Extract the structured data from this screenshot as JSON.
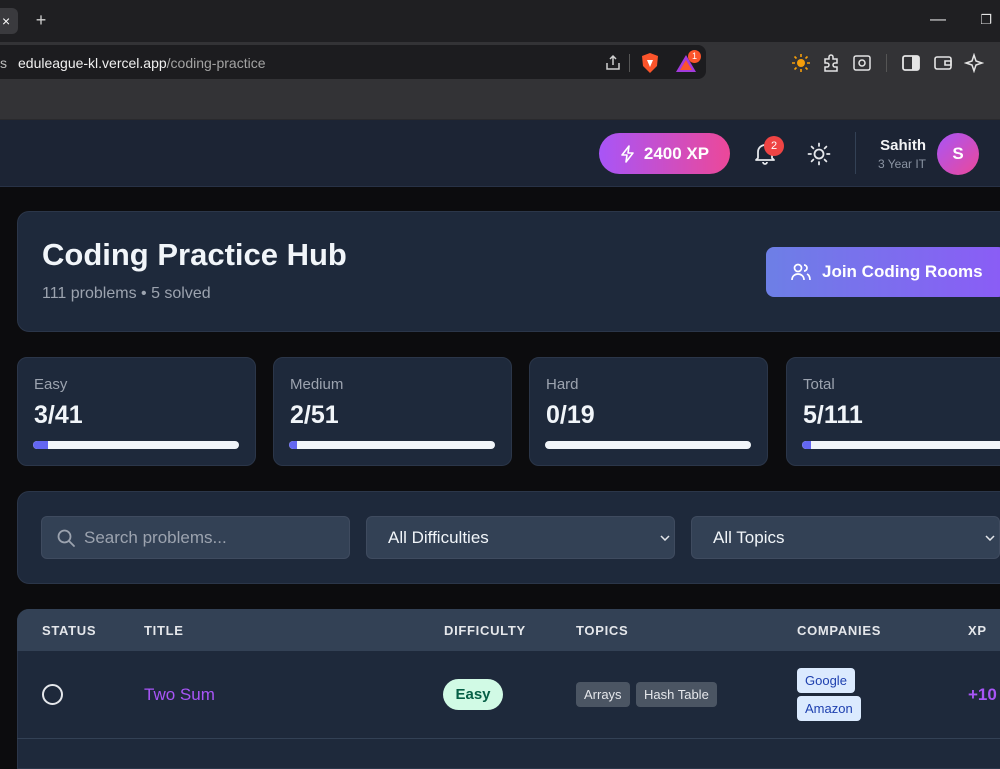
{
  "browser": {
    "tab_close": "×",
    "new_tab": "+",
    "url_prefix": "s",
    "url_host": "eduleague-kl.vercel.app",
    "url_path": "/coding-practice",
    "brave_badge": "1",
    "minimize": "—",
    "restore": "❐"
  },
  "header": {
    "xp": "2400 XP",
    "notifications": "2",
    "user_name": "Sahith",
    "user_sub": "3 Year IT",
    "avatar_initial": "S",
    "colors": {
      "xp_gradient": [
        "#a855f7",
        "#ec4899"
      ],
      "badge": "#ef4444"
    }
  },
  "hero": {
    "title": "Coding Practice Hub",
    "subtitle": "111 problems • 5 solved",
    "join_button": "Join Coding Rooms"
  },
  "stats": [
    {
      "label": "Easy",
      "value": "3/41",
      "progress": 0.073
    },
    {
      "label": "Medium",
      "value": "2/51",
      "progress": 0.039
    },
    {
      "label": "Hard",
      "value": "0/19",
      "progress": 0.0
    },
    {
      "label": "Total",
      "value": "5/111",
      "progress": 0.045
    }
  ],
  "filters": {
    "search_placeholder": "Search problems...",
    "difficulty": "All Difficulties",
    "topics": "All Topics"
  },
  "table": {
    "columns": [
      "STATUS",
      "TITLE",
      "DIFFICULTY",
      "TOPICS",
      "COMPANIES",
      "XP"
    ],
    "rows": [
      {
        "title": "Two Sum",
        "difficulty": "Easy",
        "topics": [
          "Arrays",
          "Hash Table"
        ],
        "companies": [
          "Google",
          "Amazon"
        ],
        "xp": "+10"
      }
    ]
  }
}
